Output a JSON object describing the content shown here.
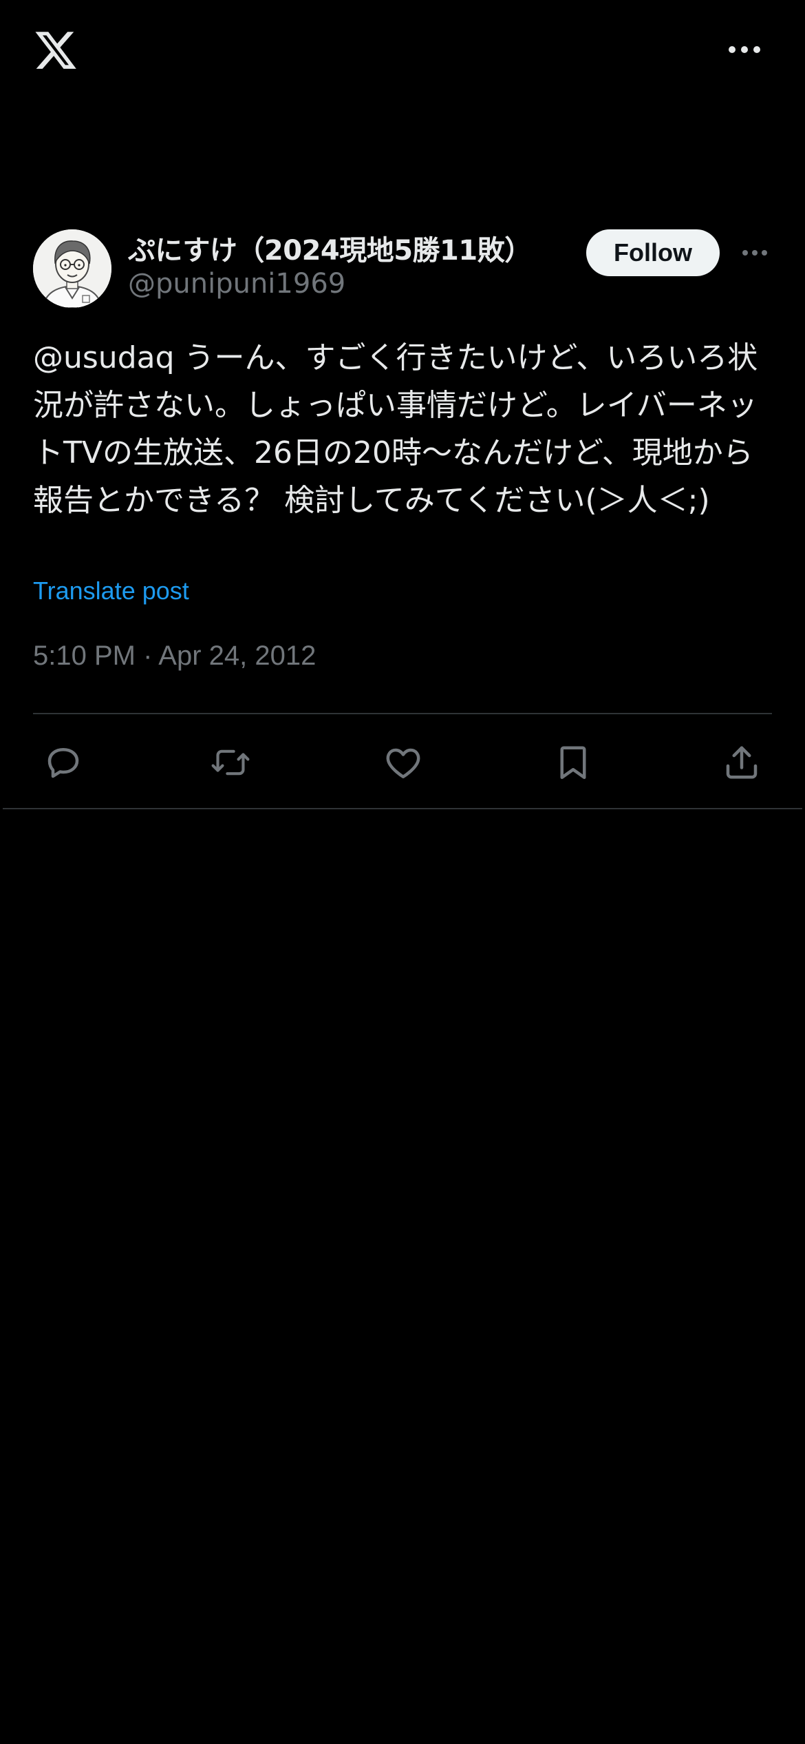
{
  "header": {
    "logo_icon": "x-logo-icon",
    "more_icon": "more-horizontal-icon"
  },
  "tweet": {
    "author": {
      "display_name": "ぷにすけ（2024現地5勝11敗）",
      "handle": "@punipuni1969",
      "avatar_icon": "avatar-sketch-portrait"
    },
    "follow_label": "Follow",
    "text": "@usudaq うーん、すごく行きたいけど、いろいろ状況が許さない。しょっぱい事情だけど。レイバーネットTVの生放送、26日の20時〜なんだけど、現地から報告とかできる？ 検討してみてください(＞人＜;)",
    "translate_label": "Translate post",
    "timestamp": "5:10 PM · Apr 24, 2012",
    "actions": [
      "reply-icon",
      "retweet-icon",
      "like-icon",
      "bookmark-icon",
      "share-icon"
    ]
  },
  "colors": {
    "background": "#000000",
    "text_primary": "#e7e9ea",
    "text_secondary": "#71767b",
    "accent": "#1d9bf0",
    "divider": "#2f3336",
    "follow_bg": "#eff3f4"
  }
}
